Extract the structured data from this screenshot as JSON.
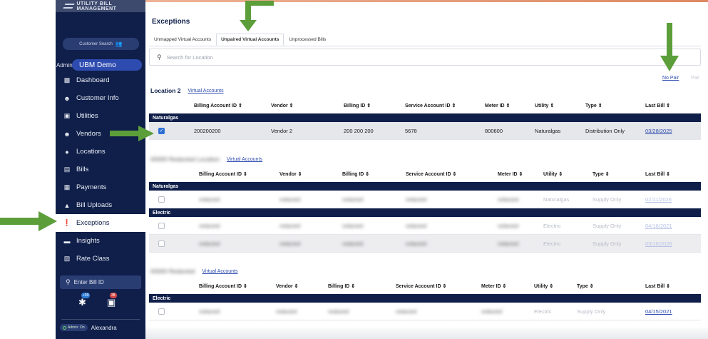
{
  "brand": "UTILITY BILL MANAGEMENT",
  "sidebar": {
    "customer_search": "Customer Search",
    "admin_label": "Admin",
    "workspace": "UBM Demo",
    "items": [
      {
        "label": "Dashboard",
        "icon": "dashboard-icon"
      },
      {
        "label": "Customer Info",
        "icon": "person-icon"
      },
      {
        "label": "Utilities",
        "icon": "utilities-icon"
      },
      {
        "label": "Vendors",
        "icon": "person-icon"
      },
      {
        "label": "Locations",
        "icon": "location-pin-icon"
      },
      {
        "label": "Bills",
        "icon": "bill-icon"
      },
      {
        "label": "Payments",
        "icon": "payment-icon"
      },
      {
        "label": "Bill Uploads",
        "icon": "upload-icon"
      },
      {
        "label": "Exceptions",
        "icon": "alert-icon",
        "active": true
      },
      {
        "label": "Insights",
        "icon": "insights-icon"
      },
      {
        "label": "Rate Class",
        "icon": "rate-class-icon"
      }
    ],
    "enter_bill": "Enter Bill ID",
    "badge_left": "+99",
    "badge_right": "38",
    "admin_toggle": "Admin: On",
    "user_name": "Alexandra"
  },
  "main": {
    "title": "Exceptions",
    "tabs": [
      "Unmapped Virtual Accounts",
      "Unpaired Virtual Accounts",
      "Unprocessed Bills"
    ],
    "active_tab": "Unpaired Virtual Accounts",
    "search_placeholder": "Search for Location",
    "no_pair": "No Pair",
    "pair": "Pair",
    "columns": [
      "Billing Account ID ⇕",
      "Vendor ⇕",
      "Billing ID ⇕",
      "Service Account ID ⇕",
      "Meter ID ⇕",
      "Utility ⇕",
      "Type ⇕",
      "Last Bill ⇕"
    ],
    "virtual_accounts_link": "Virtual Accounts",
    "locations": [
      {
        "name": "Location 2",
        "groups": [
          {
            "name": "Naturalgas",
            "rows": [
              {
                "billing_account_id": "200200200",
                "vendor": "Vendor 2",
                "billing_id": "200 200 200",
                "service_account_id": "5678",
                "meter_id": "800600",
                "utility": "Naturalgas",
                "type": "Distribution Only",
                "last_bill": "03/28/2025",
                "checked": true
              }
            ]
          }
        ]
      },
      {
        "name": "00000 Redacted Location",
        "groups": [
          {
            "name": "Naturalgas",
            "rows": [
              {
                "billing_account_id": "redacted",
                "vendor": "redacted",
                "billing_id": "redacted",
                "service_account_id": "redacted",
                "meter_id": "redacted",
                "utility": "Naturalgas",
                "type": "Supply Only",
                "last_bill": "02/11/2026"
              }
            ]
          },
          {
            "name": "Electric",
            "rows": [
              {
                "billing_account_id": "redacted",
                "vendor": "redacted",
                "billing_id": "redacted",
                "service_account_id": "redacted",
                "meter_id": "redacted",
                "utility": "Electric",
                "type": "Supply Only",
                "last_bill": "04/16/2021"
              },
              {
                "billing_account_id": "redacted",
                "vendor": "redacted",
                "billing_id": "redacted",
                "service_account_id": "redacted",
                "meter_id": "redacted",
                "utility": "Electric",
                "type": "Supply Only",
                "last_bill": "03/16/2026"
              }
            ]
          }
        ]
      },
      {
        "name": "00000 Redacted",
        "groups": [
          {
            "name": "Electric",
            "rows": [
              {
                "billing_account_id": "redacted",
                "vendor": "redacted",
                "billing_id": "redacted",
                "service_account_id": "redacted",
                "meter_id": "redacted",
                "utility": "Electric",
                "type": "Supply Only",
                "last_bill": "04/15/2021"
              }
            ]
          }
        ]
      }
    ]
  },
  "colors": {
    "sidebar": "#0f1f4a",
    "accent": "#2e4cb0",
    "arrow": "#5c9e3a",
    "group_header": "#0f1f4a"
  }
}
